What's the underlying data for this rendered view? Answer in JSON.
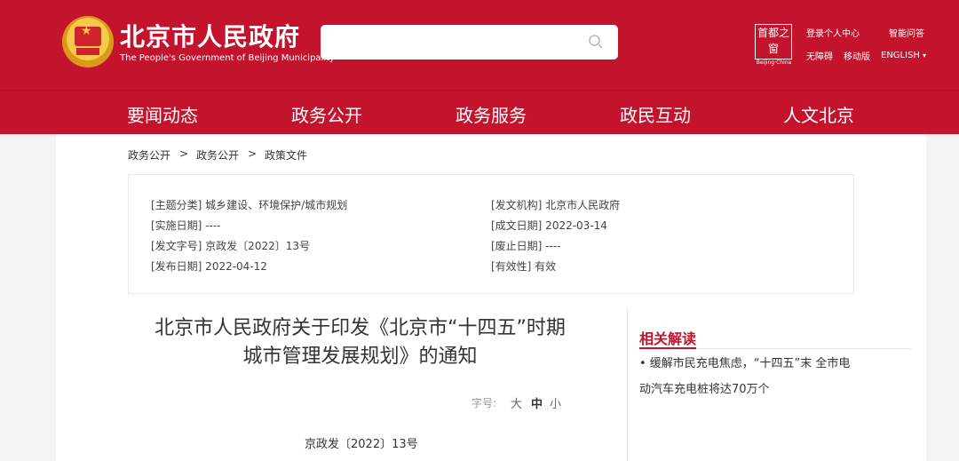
{
  "header": {
    "title": "北京市人民政府",
    "subtitle": "The People's Government of Beijing Municipality",
    "capital_logo_text": "首都之窗",
    "capital_logo_caption": "Beijing·China",
    "links": {
      "login": "登录个人中心",
      "smart_qa": "智能问答",
      "accessible": "无障碍",
      "mobile": "移动版",
      "english": "ENGLISH"
    },
    "icons": [
      "search-icon",
      "chevron-down-icon"
    ]
  },
  "search": {
    "placeholder": ""
  },
  "nav": [
    "要闻动态",
    "政务公开",
    "政务服务",
    "政民互动",
    "人文北京"
  ],
  "breadcrumb": {
    "items": [
      "政务公开",
      "政务公开",
      "政策文件"
    ],
    "separator": ">"
  },
  "meta": {
    "left": [
      "[主题分类] 城乡建设、环境保护/城市规划",
      "[实施日期] ----",
      "[发文字号] 京政发〔2022〕13号",
      "[发布日期] 2022-04-12"
    ],
    "right": [
      "[发文机构] 北京市人民政府",
      "[成文日期] 2022-03-14",
      "[废止日期] ----",
      "[有效性] 有效"
    ]
  },
  "document": {
    "title_line1": "北京市人民政府关于印发《北京市“十四五”时期",
    "title_line2": "城市管理发展规划》的通知",
    "font_size_label": "字号:",
    "font_sizes": [
      "大",
      "中",
      "小"
    ],
    "doc_number": "京政发〔2022〕13号"
  },
  "related": {
    "title": "相关解读",
    "items": [
      "• 缓解市民充电焦虑，“十四五”末 全市电动汽车充电桩将达70万个"
    ]
  },
  "colors": {
    "brand_red": "#c4142d",
    "page_bg": "#f3f3f3"
  }
}
